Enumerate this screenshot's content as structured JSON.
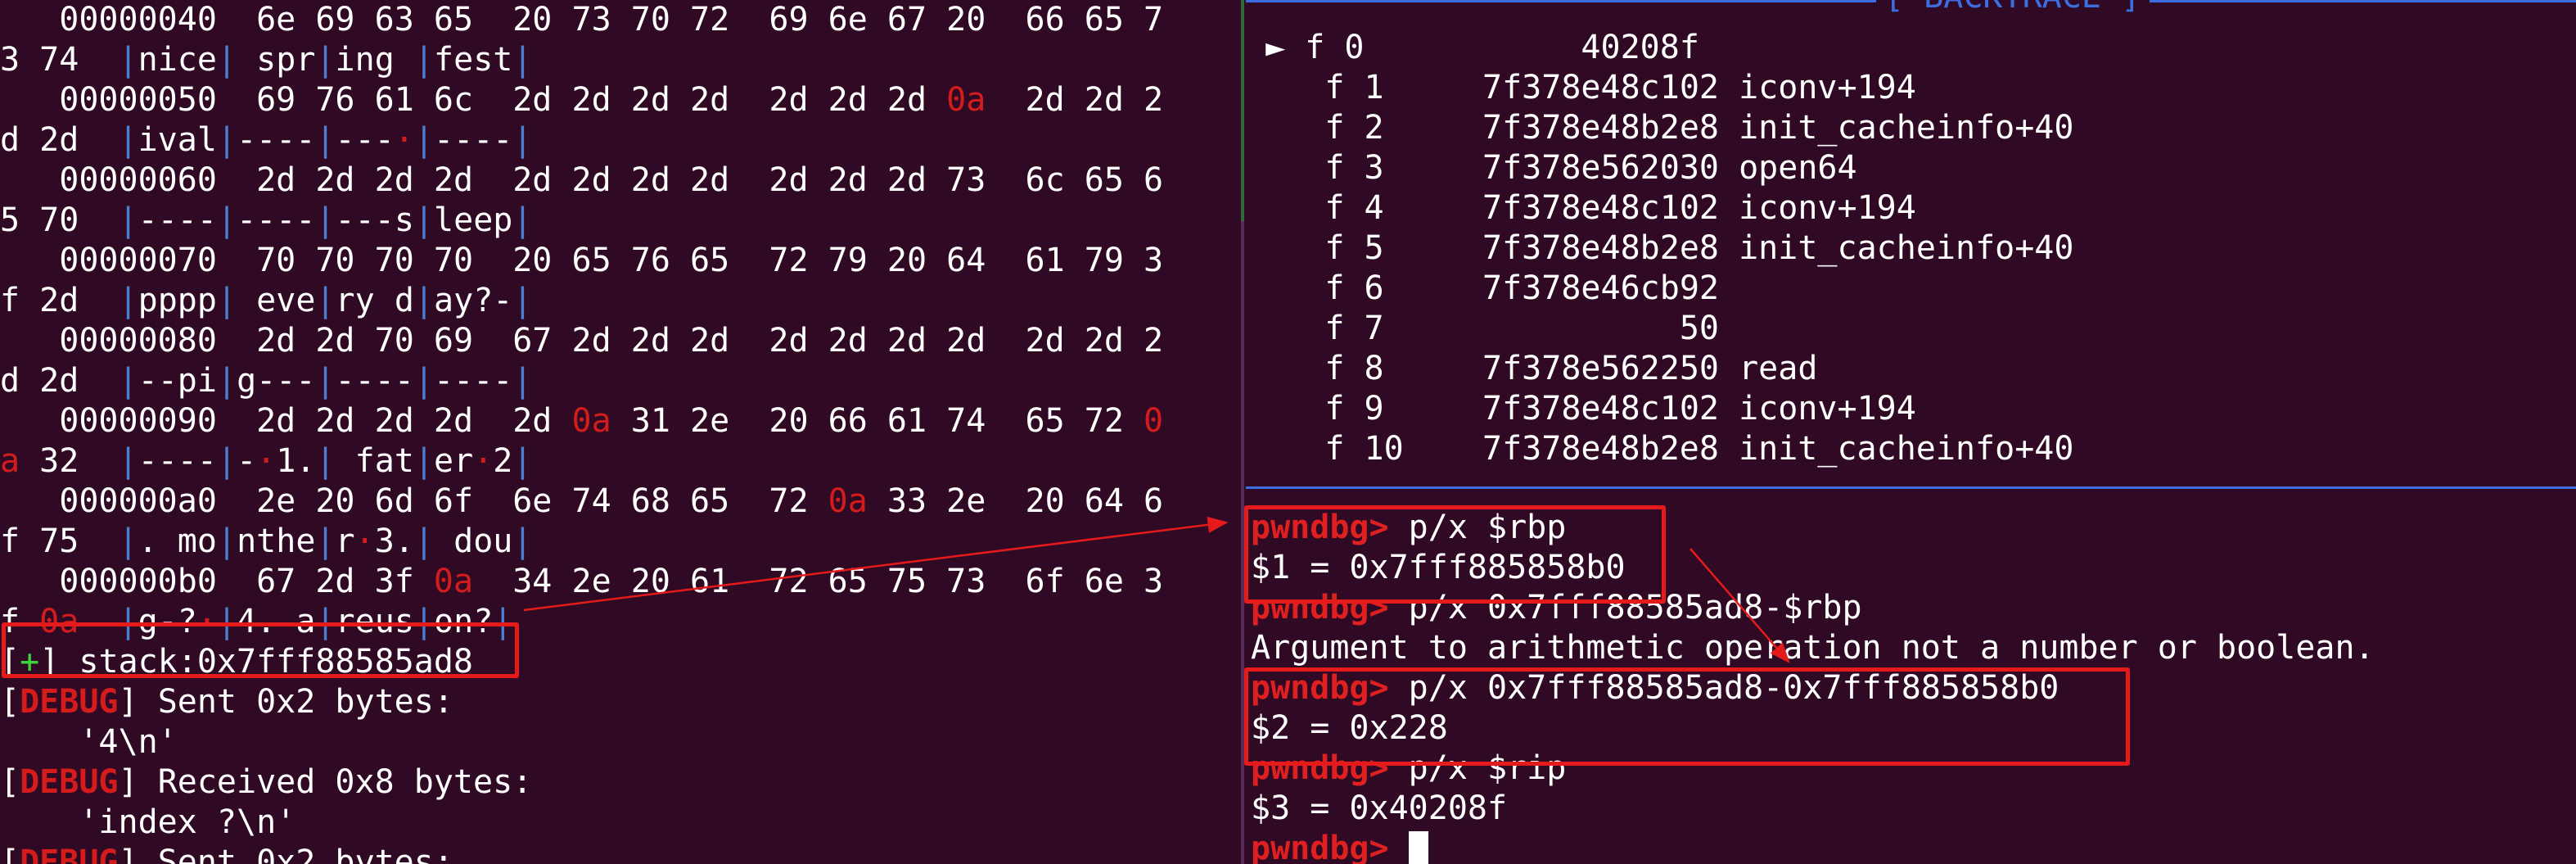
{
  "left_pane": {
    "hexdump_rows": [
      {
        "offset": "00000040",
        "bytes": [
          "6e",
          "69",
          "63",
          "65",
          "20",
          "73",
          "70",
          "72",
          "69",
          "6e",
          "67",
          "20",
          "66",
          "65",
          "7"
        ]
      },
      {
        "offset": "00000050",
        "bytes": [
          "69",
          "76",
          "61",
          "6c",
          "2d",
          "2d",
          "2d",
          "2d",
          "2d",
          "2d",
          "2d",
          "0a",
          "2d",
          "2d",
          "2"
        ]
      },
      {
        "offset": "00000060",
        "bytes": [
          "2d",
          "2d",
          "2d",
          "2d",
          "2d",
          "2d",
          "2d",
          "2d",
          "2d",
          "2d",
          "2d",
          "73",
          "6c",
          "65",
          "6"
        ]
      },
      {
        "offset": "00000070",
        "bytes": [
          "70",
          "70",
          "70",
          "70",
          "20",
          "65",
          "76",
          "65",
          "72",
          "79",
          "20",
          "64",
          "61",
          "79",
          "3"
        ]
      },
      {
        "offset": "00000080",
        "bytes": [
          "2d",
          "2d",
          "70",
          "69",
          "67",
          "2d",
          "2d",
          "2d",
          "2d",
          "2d",
          "2d",
          "2d",
          "2d",
          "2d",
          "2"
        ]
      },
      {
        "offset": "00000090",
        "bytes": [
          "2d",
          "2d",
          "2d",
          "2d",
          "2d",
          "0a",
          "31",
          "2e",
          "20",
          "66",
          "61",
          "74",
          "65",
          "72",
          "0"
        ]
      },
      {
        "offset": "000000a0",
        "bytes": [
          "2e",
          "20",
          "6d",
          "6f",
          "6e",
          "74",
          "68",
          "65",
          "72",
          "0a",
          "33",
          "2e",
          "20",
          "64",
          "6"
        ]
      },
      {
        "offset": "000000b0",
        "bytes": [
          "67",
          "2d",
          "3f",
          "0a",
          "34",
          "2e",
          "20",
          "61",
          "72",
          "65",
          "75",
          "73",
          "6f",
          "6e",
          "3"
        ]
      }
    ],
    "ascii_rows": [
      {
        "lead": "3 74",
        "cols": [
          "nice",
          " spr",
          "ing ",
          "fest"
        ]
      },
      {
        "lead": "d 2d",
        "cols": [
          "ival",
          "----",
          "---·",
          "----"
        ]
      },
      {
        "lead": "5 70",
        "cols": [
          "----",
          "----",
          "---s",
          "leep"
        ]
      },
      {
        "lead": "f 2d",
        "cols": [
          "pppp",
          " eve",
          "ry d",
          "ay?-"
        ]
      },
      {
        "lead": "d 2d",
        "cols": [
          "--pi",
          "g---",
          "----",
          "----"
        ]
      },
      {
        "lead": "a 32",
        "cols": [
          "----",
          "-·1.",
          " fat",
          "er·2"
        ]
      },
      {
        "lead": "f 75",
        "cols": [
          ". mo",
          "nthe",
          "r·3.",
          " dou"
        ]
      },
      {
        "lead": "f 0a",
        "cols": [
          "g-?·",
          "4. a",
          "reus",
          "on?"
        ]
      }
    ],
    "stack_marker": "+",
    "stack_text": "stack:0x7fff88585ad8",
    "debug_tag": "DEBUG",
    "debug_lines": [
      {
        "msg": "Sent 0x2 bytes:",
        "payload": "'4\\n'"
      },
      {
        "msg": "Received 0x8 bytes:",
        "payload": "'index ?\\n'"
      },
      {
        "msg": "Sent 0x2 bytes:",
        "payload": ""
      }
    ]
  },
  "backtrace": {
    "title": "[ BACKTRACE ]",
    "frames": [
      {
        "frame": "f 0",
        "addr": "40208f",
        "sym": "",
        "selected": true
      },
      {
        "frame": "f 1",
        "addr": "7f378e48c102",
        "sym": "iconv+194",
        "selected": false
      },
      {
        "frame": "f 2",
        "addr": "7f378e48b2e8",
        "sym": "init_cacheinfo+40",
        "selected": false
      },
      {
        "frame": "f 3",
        "addr": "7f378e562030",
        "sym": "open64",
        "selected": false
      },
      {
        "frame": "f 4",
        "addr": "7f378e48c102",
        "sym": "iconv+194",
        "selected": false
      },
      {
        "frame": "f 5",
        "addr": "7f378e48b2e8",
        "sym": "init_cacheinfo+40",
        "selected": false
      },
      {
        "frame": "f 6",
        "addr": "7f378e46cb92",
        "sym": "",
        "selected": false
      },
      {
        "frame": "f 7",
        "addr": "50",
        "sym": "",
        "selected": false
      },
      {
        "frame": "f 8",
        "addr": "7f378e562250",
        "sym": "read",
        "selected": false
      },
      {
        "frame": "f 9",
        "addr": "7f378e48c102",
        "sym": "iconv+194",
        "selected": false
      },
      {
        "frame": "f 10",
        "addr": "7f378e48b2e8",
        "sym": "init_cacheinfo+40",
        "selected": false
      }
    ]
  },
  "gdb": {
    "prompt": "pwndbg>",
    "lines": [
      {
        "type": "cmd",
        "text": "p/x $rbp"
      },
      {
        "type": "out",
        "text": "$1 = 0x7fff885858b0"
      },
      {
        "type": "cmd",
        "text": "p/x 0x7fff88585ad8-$rbp"
      },
      {
        "type": "out",
        "text": "Argument to arithmetic operation not a number or boolean."
      },
      {
        "type": "cmd",
        "text": "p/x 0x7fff88585ad8-0x7fff885858b0"
      },
      {
        "type": "out",
        "text": "$2 = 0x228"
      },
      {
        "type": "cmd",
        "text": "p/x $rip"
      },
      {
        "type": "out",
        "text": "$3 = 0x40208f"
      },
      {
        "type": "cmd",
        "text": ""
      }
    ]
  },
  "colors": {
    "background": "#300a24",
    "annotation_red": "#e51b1b",
    "pipe_blue": "#4a7fd4",
    "rule_blue": "#3d6ee0",
    "debug_red": "#d41c1c"
  }
}
